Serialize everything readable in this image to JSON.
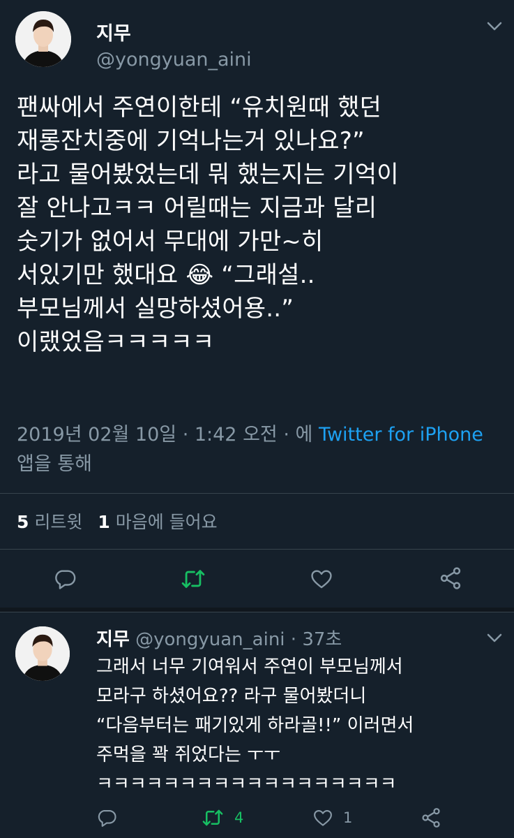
{
  "main_tweet": {
    "author_name": "지무",
    "author_handle": "@yongyuan_aini",
    "text": "팬싸에서 주연이한테 “유치원때 했던\n재롱잔치중에 기억나는거 있나요?”\n라고 물어봤었는데 뭐 했는지는 기억이\n잘 안나고ㅋㅋ 어릴때는 지금과 달리\n숫기가 없어서 무대에 가만~히\n서있기만 했대요 😂 “그래설..\n부모님께서 실망하셨어용..”\n이랬었음ㅋㅋㅋㅋㅋ",
    "timestamp": "2019년 02월 10일 · 1:42 오전 · 에 ",
    "source_link": "Twitter for iPhone",
    "source_suffix": " 앱을 통해",
    "retweet_count": "5",
    "retweet_label": "리트윗",
    "like_count": "1",
    "like_label": "마음에 들어요"
  },
  "reply_tweet": {
    "author_name": "지무",
    "author_handle": "@yongyuan_aini",
    "time": " · 37초",
    "text": "그래서 너무 기여워서 주연이 부모님께서\n모라구 하셨어요?? 라구 물어봤더니\n“다음부터는 패기있게 하라골!!” 이러면서\n주먹을 꽉 쥐었다는 ㅜㅜ\nㅋㅋㅋㅋㅋㅋㅋㅋㅋㅋㅋㅋㅋㅋㅋㅋㅋㅋ",
    "retweet_count": "4",
    "like_count": "1"
  },
  "icons": [
    "reply-icon",
    "retweet-icon",
    "like-icon",
    "share-icon",
    "chevron-down-icon"
  ],
  "colors": {
    "background": "#15202b",
    "secondary_text": "#8899a6",
    "link": "#1da1f2",
    "retweet_active": "#17bf63",
    "divider": "#38444d"
  }
}
